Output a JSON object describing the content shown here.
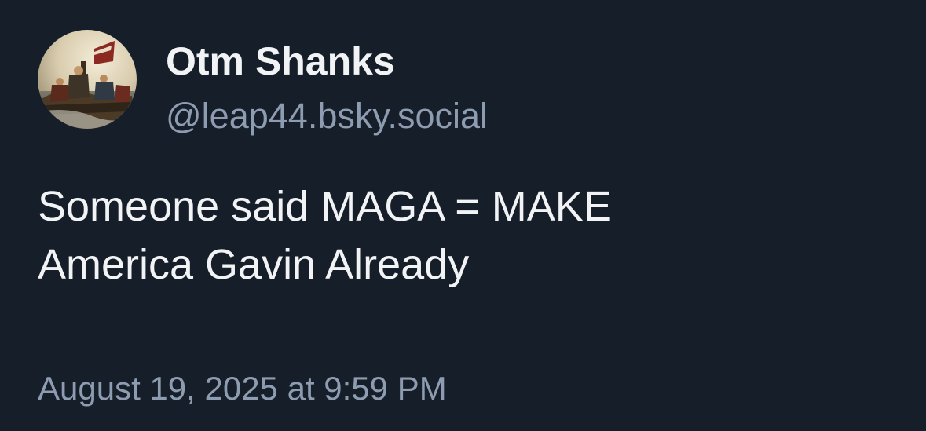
{
  "post": {
    "author": {
      "display_name": "Otm Shanks",
      "handle": "@leap44.bsky.social",
      "avatar_icon": "avatar-painting-image"
    },
    "text_lines": [
      "Someone said MAGA = MAKE",
      "America Gavin Already"
    ],
    "timestamp": "August 19, 2025 at 9:59 PM"
  },
  "colors": {
    "background": "#161e29",
    "primary_text": "#f1f3f5",
    "secondary_text": "#8d9cb0"
  }
}
